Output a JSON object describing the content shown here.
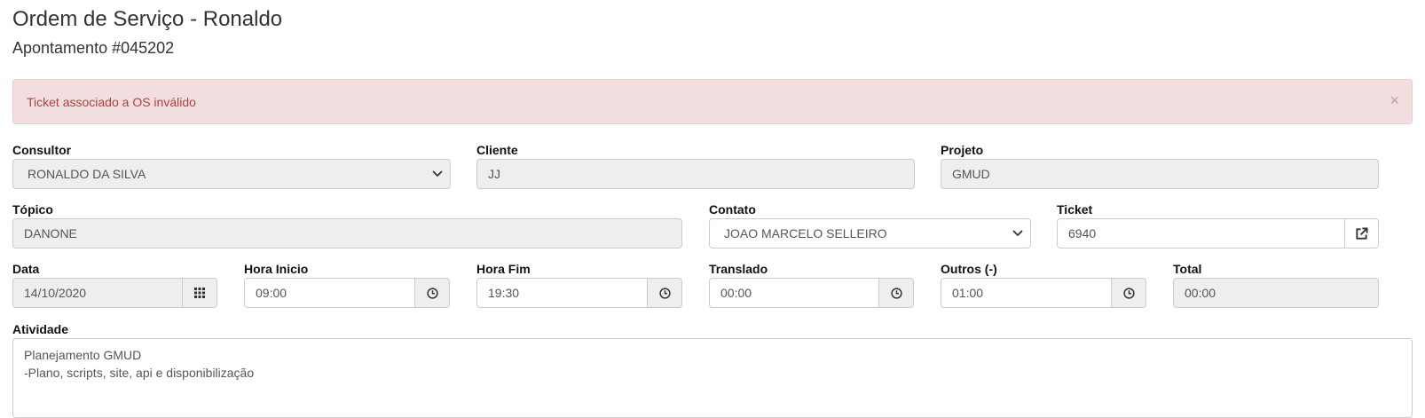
{
  "header": {
    "title": "Ordem de Serviço - Ronaldo",
    "subtitle": "Apontamento #045202"
  },
  "alert": {
    "message": "Ticket associado a OS inválido",
    "close_symbol": "×",
    "color": "#a94442",
    "background": "#f2dede"
  },
  "form": {
    "consultor": {
      "label": "Consultor",
      "value": "RONALDO DA SILVA"
    },
    "cliente": {
      "label": "Cliente",
      "value": "JJ"
    },
    "projeto": {
      "label": "Projeto",
      "value": "GMUD"
    },
    "topico": {
      "label": "Tópico",
      "value": "DANONE"
    },
    "contato": {
      "label": "Contato",
      "value": "JOAO MARCELO SELLEIRO"
    },
    "ticket": {
      "label": "Ticket",
      "value": "6940",
      "icon": "external-link-icon"
    },
    "data": {
      "label": "Data",
      "value": "14/10/2020",
      "icon": "calendar-grid-icon"
    },
    "hora_inicio": {
      "label": "Hora Inicio",
      "value": "09:00",
      "icon": "clock-icon"
    },
    "hora_fim": {
      "label": "Hora Fim",
      "value": "19:30",
      "icon": "clock-icon"
    },
    "translado": {
      "label": "Translado",
      "value": "00:00",
      "icon": "clock-icon"
    },
    "outros": {
      "label": "Outros (-)",
      "value": "01:00",
      "icon": "clock-icon"
    },
    "total": {
      "label": "Total",
      "value": "00:00"
    },
    "atividade": {
      "label": "Atividade",
      "lines": [
        "Planejamento GMUD",
        "-Plano, scripts, site, api e disponibilização"
      ]
    }
  }
}
